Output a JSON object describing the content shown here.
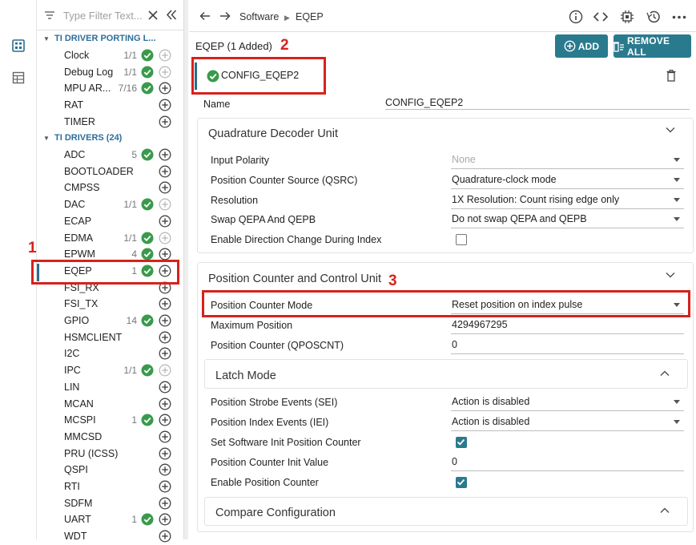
{
  "colors": {
    "accent": "#2a7a8e",
    "check": "#3a9a4c",
    "annotation": "#d6221c",
    "group": "#2c6e9b"
  },
  "rail": {
    "icons": [
      "dashboard-icon",
      "table-icon"
    ]
  },
  "filter": {
    "placeholder": "Type Filter Text..."
  },
  "tree": {
    "groups": [
      {
        "label": "TI DRIVER PORTING L..."
      },
      {
        "label": "TI DRIVERS (24)"
      }
    ],
    "porting_items": [
      {
        "name": "Clock",
        "count": "1/1",
        "check": true,
        "add_disabled": true
      },
      {
        "name": "Debug Log",
        "count": "1/1",
        "check": true,
        "add_disabled": true
      },
      {
        "name": "MPU AR...",
        "count": "7/16",
        "check": true,
        "add_disabled": false
      },
      {
        "name": "RAT",
        "count": "",
        "check": false,
        "add_disabled": false
      },
      {
        "name": "TIMER",
        "count": "",
        "check": false,
        "add_disabled": false
      }
    ],
    "driver_items": [
      {
        "name": "ADC",
        "count": "5",
        "check": true,
        "add_disabled": false
      },
      {
        "name": "BOOTLOADER",
        "count": "",
        "check": false,
        "add_disabled": false
      },
      {
        "name": "CMPSS",
        "count": "",
        "check": false,
        "add_disabled": false
      },
      {
        "name": "DAC",
        "count": "1/1",
        "check": true,
        "add_disabled": true
      },
      {
        "name": "ECAP",
        "count": "",
        "check": false,
        "add_disabled": false
      },
      {
        "name": "EDMA",
        "count": "1/1",
        "check": true,
        "add_disabled": true
      },
      {
        "name": "EPWM",
        "count": "4",
        "check": true,
        "add_disabled": false
      },
      {
        "name": "EQEP",
        "count": "1",
        "check": true,
        "add_disabled": false
      },
      {
        "name": "FSI_RX",
        "count": "",
        "check": false,
        "add_disabled": false
      },
      {
        "name": "FSI_TX",
        "count": "",
        "check": false,
        "add_disabled": false
      },
      {
        "name": "GPIO",
        "count": "14",
        "check": true,
        "add_disabled": false
      },
      {
        "name": "HSMCLIENT",
        "count": "",
        "check": false,
        "add_disabled": false
      },
      {
        "name": "I2C",
        "count": "",
        "check": false,
        "add_disabled": false
      },
      {
        "name": "IPC",
        "count": "1/1",
        "check": true,
        "add_disabled": true
      },
      {
        "name": "LIN",
        "count": "",
        "check": false,
        "add_disabled": false
      },
      {
        "name": "MCAN",
        "count": "",
        "check": false,
        "add_disabled": false
      },
      {
        "name": "MCSPI",
        "count": "1",
        "check": true,
        "add_disabled": false
      },
      {
        "name": "MMCSD",
        "count": "",
        "check": false,
        "add_disabled": false
      },
      {
        "name": "PRU (ICSS)",
        "count": "",
        "check": false,
        "add_disabled": false
      },
      {
        "name": "QSPI",
        "count": "",
        "check": false,
        "add_disabled": false
      },
      {
        "name": "RTI",
        "count": "",
        "check": false,
        "add_disabled": false
      },
      {
        "name": "SDFM",
        "count": "",
        "check": false,
        "add_disabled": false
      },
      {
        "name": "UART",
        "count": "1",
        "check": true,
        "add_disabled": false
      },
      {
        "name": "WDT",
        "count": "",
        "check": false,
        "add_disabled": false
      }
    ]
  },
  "breadcrumb": {
    "root": "Software",
    "current": "EQEP"
  },
  "header": {
    "title": "EQEP (1 Added)",
    "add_label": "ADD",
    "remove_label": "REMOVE ALL"
  },
  "instance": {
    "name": "CONFIG_EQEP2"
  },
  "name_field": {
    "label": "Name",
    "value": "CONFIG_EQEP2"
  },
  "qdu": {
    "title": "Quadrature Decoder Unit",
    "rows": [
      {
        "label": "Input Polarity",
        "value": "None",
        "kind": "select",
        "disabled": true
      },
      {
        "label": "Position Counter Source (QSRC)",
        "value": "Quadrature-clock mode",
        "kind": "select",
        "disabled": false
      },
      {
        "label": "Resolution",
        "value": "1X Resolution: Count rising edge only",
        "kind": "select",
        "disabled": false
      },
      {
        "label": "Swap QEPA And QEPB",
        "value": "Do not swap QEPA and QEPB",
        "kind": "select",
        "disabled": false
      },
      {
        "label": "Enable Direction Change During Index",
        "value": "",
        "kind": "checkbox",
        "checked": false
      }
    ]
  },
  "pccu": {
    "title": "Position Counter and Control Unit",
    "rows": [
      {
        "label": "Position Counter Mode",
        "value": "Reset position on index pulse",
        "kind": "select",
        "disabled": false
      },
      {
        "label": "Maximum Position",
        "value": "4294967295",
        "kind": "text"
      },
      {
        "label": "Position Counter (QPOSCNT)",
        "value": "0",
        "kind": "text"
      }
    ]
  },
  "latch": {
    "title": "Latch Mode",
    "rows": [
      {
        "label": "Position Strobe Events (SEI)",
        "value": "Action is disabled",
        "kind": "select",
        "disabled": false
      },
      {
        "label": "Position Index Events (IEI)",
        "value": "Action is disabled",
        "kind": "select",
        "disabled": false
      },
      {
        "label": "Set Software Init Position Counter",
        "value": "",
        "kind": "checkbox",
        "checked": true
      },
      {
        "label": "Position Counter Init Value",
        "value": "0",
        "kind": "text"
      },
      {
        "label": "Enable Position Counter",
        "value": "",
        "kind": "checkbox",
        "checked": true
      }
    ]
  },
  "compare": {
    "title": "Compare Configuration"
  },
  "annotations": [
    "1",
    "2",
    "3"
  ]
}
